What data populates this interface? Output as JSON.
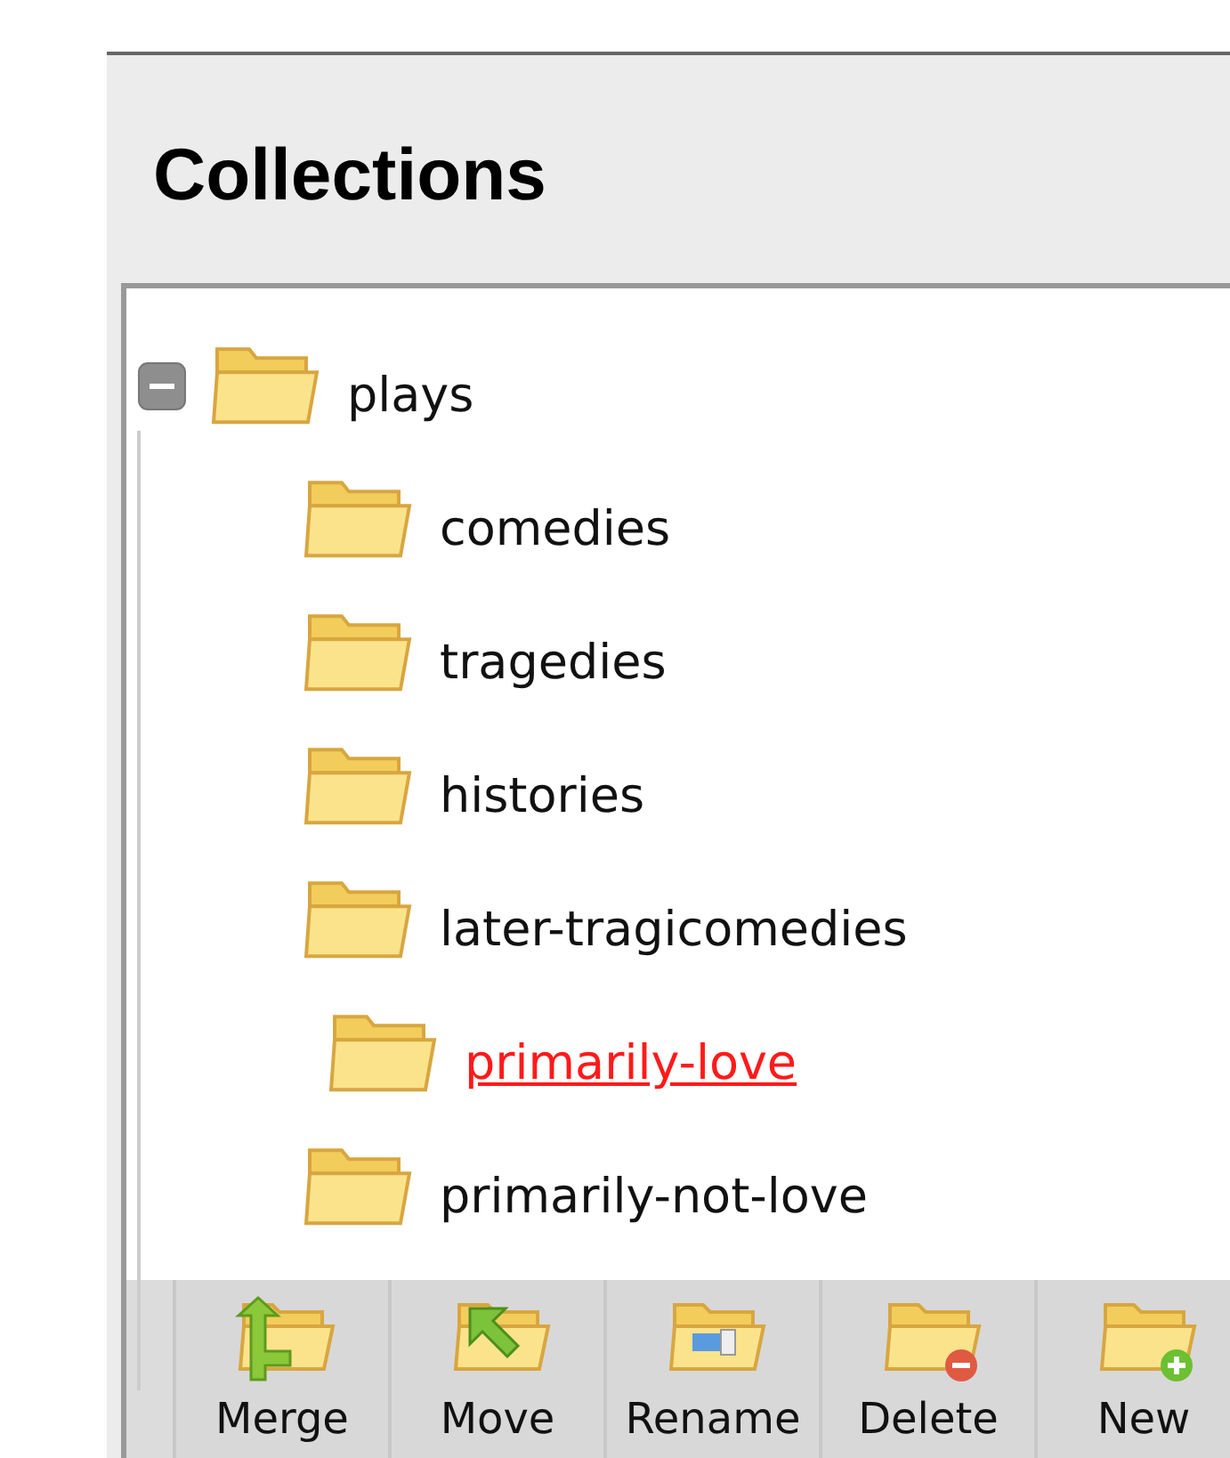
{
  "panel": {
    "title": "Collections"
  },
  "tree": [
    {
      "label": "plays",
      "expanded": true,
      "selected": false,
      "children": [
        {
          "label": "comedies",
          "selected": false
        },
        {
          "label": "tragedies",
          "selected": false
        },
        {
          "label": "histories",
          "selected": false
        },
        {
          "label": "later-tragicomedies",
          "selected": false
        },
        {
          "label": "primarily-love",
          "selected": true
        },
        {
          "label": "primarily-not-love",
          "selected": false
        }
      ]
    }
  ],
  "toolbar": [
    {
      "kind": "merge",
      "label": "Merge"
    },
    {
      "kind": "move",
      "label": "Move"
    },
    {
      "kind": "rename",
      "label": "Rename"
    },
    {
      "kind": "delete",
      "label": "Delete"
    },
    {
      "kind": "new",
      "label": "New"
    }
  ]
}
